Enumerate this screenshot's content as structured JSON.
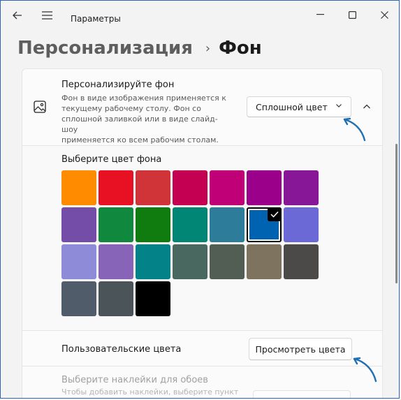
{
  "window": {
    "app_title": "Параметры",
    "back_icon": "back-arrow-icon",
    "menu_icon": "hamburger-menu-icon",
    "controls": [
      "minimize-icon",
      "maximize-icon",
      "close-icon"
    ]
  },
  "breadcrumb": {
    "parent": "Персонализация",
    "separator": "›",
    "current": "Фон"
  },
  "background_card": {
    "icon": "image-icon",
    "title": "Персонализируйте фон",
    "description_lines": [
      "Фон в виде изображения применяется к",
      "текущему рабочему столу. Фон со",
      "сплошной заливкой или в виде слайд-шоу",
      "применяется ко всем рабочим столам."
    ],
    "dropdown_value": "Сплошной цвет",
    "dropdown_chevron": "chevron-down-icon",
    "collapse_icon": "chevron-up-icon"
  },
  "color_picker": {
    "title": "Выберите цвет фона",
    "rows": [
      [
        "#ff8c00",
        "#e81123",
        "#d13438",
        "#c30052",
        "#bf0077",
        "#9a0089",
        "#881798"
      ],
      [
        "#744da9",
        "#10893e",
        "#107c10",
        "#018574",
        "#2d7d9a",
        "#0063b1",
        "#6b69d6"
      ],
      [
        "#8e8cd8",
        "#8764b8",
        "#038387",
        "#486860",
        "#525e54",
        "#7e735f",
        "#4c4a48"
      ],
      [
        "#515c6b",
        "#4a5459",
        "#000000"
      ]
    ],
    "selected": {
      "row": 1,
      "col": 5
    },
    "check_icon": "checkmark-icon"
  },
  "custom_colors": {
    "label": "Пользовательские цвета",
    "button": "Просмотреть цвета"
  },
  "stickers": {
    "title": "Выберите наклейки для обоев",
    "description": "Чтобы добавить наклейки, выберите пункт"
  },
  "accent_color": "#1f6fb2"
}
